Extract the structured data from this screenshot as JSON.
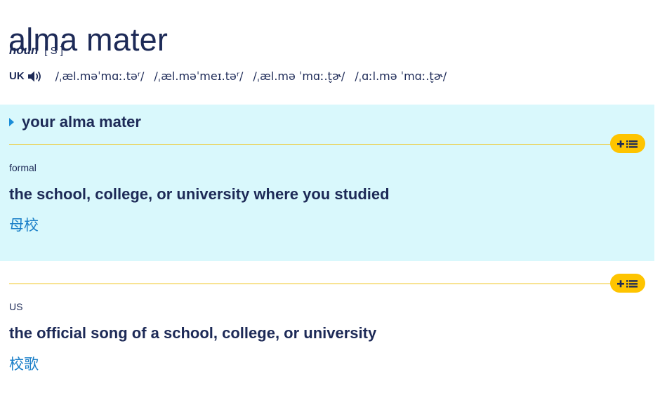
{
  "entry": {
    "headword": "alma mater",
    "part_of_speech": "noun",
    "grammar": "[ S ]",
    "region": "UK",
    "pronunciations": [
      "/ˌæl.məˈmɑː.təʳ/",
      "/ˌæl.məˈmeɪ.təʳ/",
      "/ˌæl.mə ˈmɑː.t̬ɚ/",
      "/ˌɑːl.mə ˈmɑː.t̬ɚ/"
    ]
  },
  "senses": [
    {
      "guideword": "your alma mater",
      "label": "formal",
      "definition": "the school, college, or university where you studied",
      "translation": "母校"
    },
    {
      "label": "US",
      "definition": "the official song of a school, college, or university",
      "translation": "校歌"
    }
  ],
  "colors": {
    "primary_text": "#1d2a57",
    "sense_background": "#d9f8fc",
    "accent_yellow": "#fec400",
    "translation_blue": "#1a7fc8",
    "caret_blue": "#1a8dd8"
  },
  "icons": {
    "speaker": "speaker-icon",
    "add_to_list": "plus-list-icon",
    "caret": "caret-right-icon"
  }
}
